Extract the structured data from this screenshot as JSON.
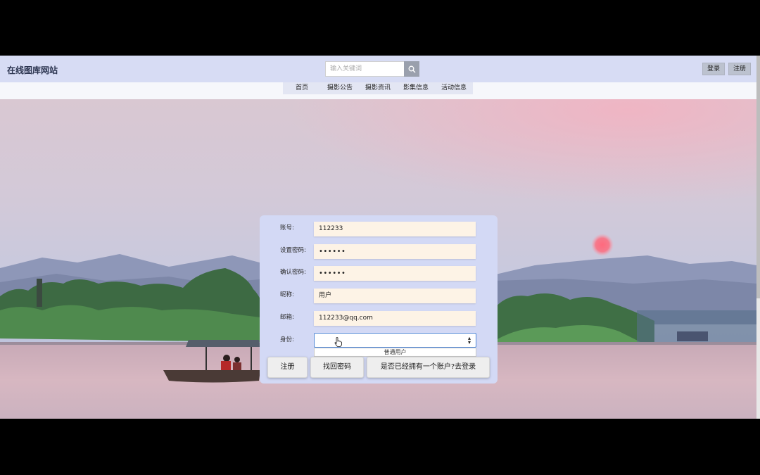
{
  "header": {
    "brand": "在线图库网站",
    "search_placeholder": "输入关键词",
    "login_label": "登录",
    "register_label": "注册"
  },
  "nav": {
    "items": [
      "首页",
      "摄影公告",
      "摄影资讯",
      "影集信息",
      "活动信息"
    ]
  },
  "form": {
    "account_label": "账号:",
    "account_value": "112233",
    "password_label": "设置密码:",
    "password_value": "••••••",
    "confirm_label": "确认密码:",
    "confirm_value": "••••••",
    "nickname_label": "昵称:",
    "nickname_value": "用户",
    "email_label": "邮箱:",
    "email_value": "112233@qq.com",
    "role_label": "身份:",
    "role_selected": "",
    "role_options": [
      "普通用户"
    ]
  },
  "buttons": {
    "register": "注册",
    "find_password": "找回密码",
    "go_login": "是否已经拥有一个账户?去登录"
  },
  "colors": {
    "header_bg": "#d7dcf4",
    "card_bg": "#d3d9f5",
    "field_bg": "#fdf3e6",
    "select_focus": "#4f86d6"
  }
}
